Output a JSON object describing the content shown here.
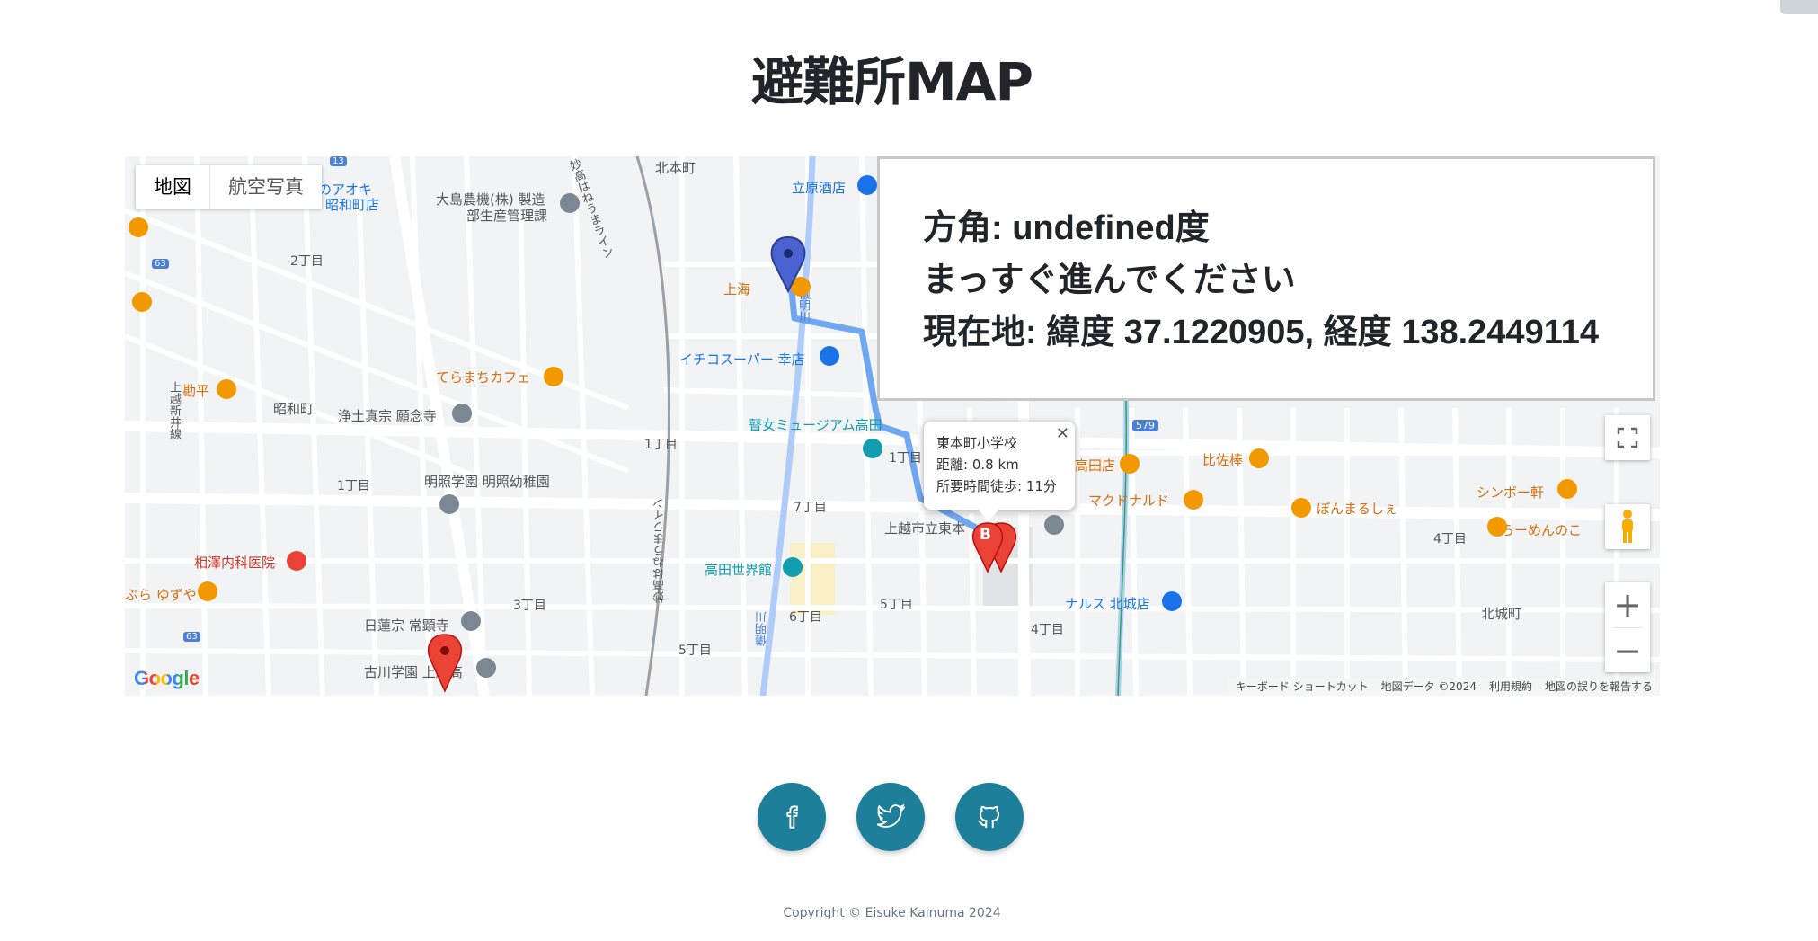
{
  "page": {
    "title": "避難所MAP",
    "copyright": "Copyright © Eisuke Kainuma 2024"
  },
  "map": {
    "type_controls": [
      "地図",
      "航空写真"
    ],
    "labels": [
      "北本町",
      "立原酒店",
      "大島農機(株) 製造",
      "部生産管理課",
      "リのアオキ",
      "昭和町店",
      "2丁目",
      "上海",
      "イチコスーパー 幸店",
      "てらまちカフェ",
      "勘平",
      "昭和町",
      "浄土真宗 願念寺",
      "上越新井線",
      "1丁目",
      "1丁目",
      "明照学園 明照幼稚園",
      "瞽女ミュージアム高田",
      "1丁目",
      "7丁目",
      "上越市立東本",
      "高田世界館",
      "相澤内科医院",
      "ぶら ゆずや",
      "3丁目",
      "日蓮宗 常顕寺",
      "古川学園 上越高",
      "5丁目",
      "6丁目",
      "5丁目",
      "4丁目",
      "高田店",
      "比佐棒",
      "マクドナルド",
      "ぽんまるしぇ",
      "シンボー軒",
      "らーめんのこ",
      "4丁目",
      "北城町",
      "ナルス 北城店",
      "妙高はねうまライン",
      "妙高はねうまライン",
      "儀明川",
      "儀明川",
      "579",
      "63",
      "63",
      "13"
    ],
    "info_window": {
      "name": "東本町小学校",
      "distance": "距離: 0.8 km",
      "walk_time": "所要時間徒歩: 11分"
    },
    "marker_label": "B",
    "google": "Google",
    "attribution": [
      "キーボード ショートカット",
      "地図データ ©2024",
      "利用規約",
      "地図の誤りを報告する"
    ],
    "zoom_in": "+",
    "zoom_out": "−"
  },
  "info_panel": {
    "direction": "方角: undefined度",
    "instruction": "まっすぐ進んでください",
    "location": "現在地: 緯度 37.1220905, 経度 138.2449114"
  },
  "social": [
    {
      "name": "facebook",
      "icon": "facebook-icon"
    },
    {
      "name": "twitter",
      "icon": "twitter-icon"
    },
    {
      "name": "github",
      "icon": "github-icon"
    }
  ],
  "colors": {
    "social_bg": "#1e7f9a",
    "route": "#6fa8f0",
    "marker_red": "#ea4335",
    "poi_orange": "#f29900",
    "poi_blue": "#1a73e8"
  }
}
